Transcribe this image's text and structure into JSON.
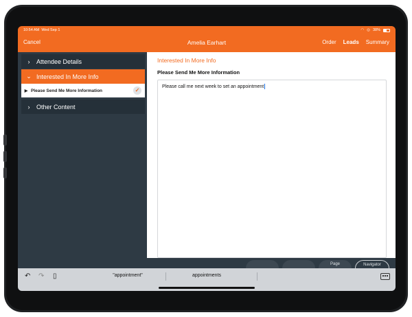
{
  "status": {
    "time": "10:54 AM",
    "date": "Wed Sep 1",
    "battery": "38%"
  },
  "nav": {
    "cancel": "Cancel",
    "title": "Amelia Earhart",
    "links": [
      "Order",
      "Leads",
      "Summary"
    ],
    "active_link": "Leads"
  },
  "sidebar": {
    "groups": [
      {
        "label": "Attendee Details",
        "expanded": false
      },
      {
        "label": "Interested In More Info",
        "expanded": true
      },
      {
        "label": "Other Content",
        "expanded": false
      }
    ],
    "subitem": {
      "label": "Please Send Me More Information",
      "checked": true
    }
  },
  "main": {
    "section_title": "Interested In More Info",
    "field_label": "Please Send Me More Information",
    "field_value": "Please call me next week to set an appointment"
  },
  "bottombar": {
    "buttons": [
      "",
      "",
      "Page",
      "Navigator"
    ]
  },
  "keyboard": {
    "suggestions": [
      "\"appointment\"",
      "appointments",
      ""
    ]
  },
  "colors": {
    "accent": "#f26b21",
    "sidebar": "#2e3a44",
    "sidebar_item": "#253039"
  }
}
